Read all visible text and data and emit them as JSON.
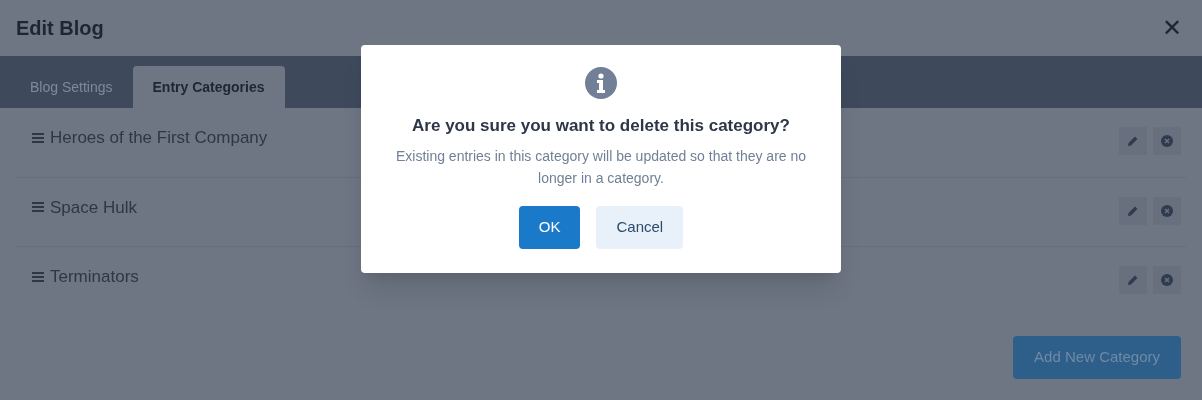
{
  "window": {
    "title": "Edit Blog",
    "close": "✕"
  },
  "tabs": [
    {
      "label": "Blog Settings",
      "selected": false
    },
    {
      "label": "Entry Categories",
      "selected": true
    }
  ],
  "categories": [
    {
      "name": "Heroes of the First Company"
    },
    {
      "name": "Space Hulk"
    },
    {
      "name": "Terminators"
    }
  ],
  "add_button": "Add New Category",
  "dialog": {
    "title": "Are you sure you want to delete this category?",
    "message": "Existing entries in this category will be updated so that they are no longer in a category.",
    "buttons": [
      {
        "label": "OK",
        "kind": "primary"
      },
      {
        "label": "Cancel",
        "kind": "secondary"
      }
    ]
  }
}
